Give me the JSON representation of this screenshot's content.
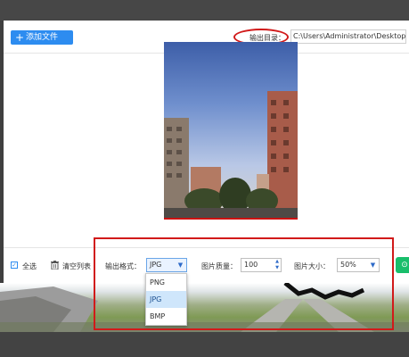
{
  "toolbar": {
    "add_button_label": "添加文件",
    "output_dir_label": "输出目录：",
    "output_dir_value": "C:\\Users\\Administrator\\Desktop\\"
  },
  "controls": {
    "select_all_label": "全选",
    "clear_list_label": "清空列表",
    "format_label": "输出格式：",
    "format_value": "JPG",
    "quality_label": "图片质量：",
    "quality_value": "100",
    "size_label": "图片大小：",
    "size_value": "50%"
  },
  "format_dropdown": {
    "options": [
      "PNG",
      "JPG",
      "BMP"
    ],
    "selected": "JPG"
  },
  "icons": {
    "add": "plus-icon",
    "checkbox": "check-icon",
    "clear": "trash-icon",
    "dropdown": "chevron-down-icon",
    "spinner": "spinner-arrows-icon",
    "action": "green-action-icon"
  },
  "colors": {
    "accent": "#2d8cf0",
    "highlight": "#d11a1a",
    "action_green": "#19be6b",
    "selected_option": "#cfe6fb"
  }
}
